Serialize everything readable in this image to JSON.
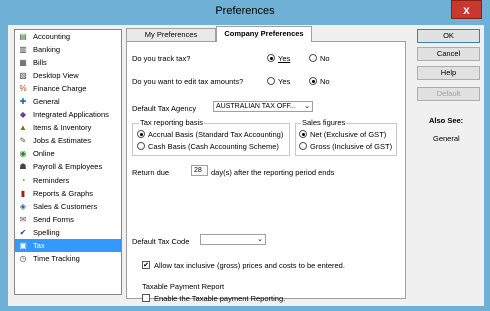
{
  "window": {
    "title": "Preferences",
    "close_label": "x"
  },
  "sidebar": {
    "items": [
      {
        "label": "Accounting",
        "icon": "accounting-icon",
        "glyph": "▤",
        "color": "#2c6e2c"
      },
      {
        "label": "Banking",
        "icon": "bank-icon",
        "glyph": "▥",
        "color": "#444"
      },
      {
        "label": "Bills",
        "icon": "bills-icon",
        "glyph": "▦",
        "color": "#444"
      },
      {
        "label": "Desktop View",
        "icon": "desktop-icon",
        "glyph": "▧",
        "color": "#444"
      },
      {
        "label": "Finance Charge",
        "icon": "finance-charge-icon",
        "glyph": "%",
        "color": "#b04a00"
      },
      {
        "label": "General",
        "icon": "general-icon",
        "glyph": "✚",
        "color": "#1a6aa0"
      },
      {
        "label": "Integrated Applications",
        "icon": "apps-icon",
        "glyph": "◆",
        "color": "#6a3a9a"
      },
      {
        "label": "Items & Inventory",
        "icon": "inventory-icon",
        "glyph": "▲",
        "color": "#8a6a00"
      },
      {
        "label": "Jobs & Estimates",
        "icon": "jobs-icon",
        "glyph": "✎",
        "color": "#555"
      },
      {
        "label": "Online",
        "icon": "online-icon",
        "glyph": "◉",
        "color": "#2a8a2a"
      },
      {
        "label": "Payroll & Employees",
        "icon": "payroll-icon",
        "glyph": "☗",
        "color": "#444"
      },
      {
        "label": "Reminders",
        "icon": "reminders-icon",
        "glyph": "◔",
        "color": "#c07000"
      },
      {
        "label": "Reports & Graphs",
        "icon": "reports-icon",
        "glyph": "▮",
        "color": "#a02020"
      },
      {
        "label": "Sales & Customers",
        "icon": "sales-icon",
        "glyph": "◈",
        "color": "#2060a0"
      },
      {
        "label": "Send Forms",
        "icon": "send-forms-icon",
        "glyph": "✉",
        "color": "#555"
      },
      {
        "label": "Spelling",
        "icon": "spelling-icon",
        "glyph": "✔",
        "color": "#1a4fa0"
      },
      {
        "label": "Tax",
        "icon": "tax-icon",
        "glyph": "▣",
        "color": "#fff"
      },
      {
        "label": "Time Tracking",
        "icon": "time-icon",
        "glyph": "◷",
        "color": "#444"
      }
    ],
    "selected_index": 16
  },
  "tabs": {
    "my": "My Preferences",
    "company": "Company Preferences"
  },
  "panel": {
    "track_tax_q": "Do you track tax?",
    "edit_tax_q": "Do you want to edit tax amounts?",
    "yes": "Yes",
    "no": "No",
    "default_agency_label": "Default Tax Agency",
    "default_agency_value": "AUSTRALIAN TAX OFF...",
    "reporting_basis_title": "Tax reporting basis",
    "accrual": "Accrual Basis (Standard Tax Accounting)",
    "cash": "Cash Basis (Cash Accounting Scheme)",
    "sales_figures_title": "Sales figures",
    "net": "Net  (Exclusive of GST)",
    "gross": "Gross (Inclusive of GST)",
    "return_due_label": "Return due",
    "return_due_value": "28",
    "return_due_suffix": "day(s) after the reporting period ends",
    "default_tax_code_label": "Default Tax Code",
    "default_tax_code_value": "",
    "allow_inclusive": "Allow tax inclusive (gross) prices and costs to be entered.",
    "taxable_payment_title": "Taxable Payment Report",
    "enable_taxable": "Enable the Taxable payment Reporting."
  },
  "buttons": {
    "ok": "OK",
    "cancel": "Cancel",
    "help": "Help",
    "default": "Default"
  },
  "also_see": {
    "title": "Also See:",
    "link": "General"
  }
}
